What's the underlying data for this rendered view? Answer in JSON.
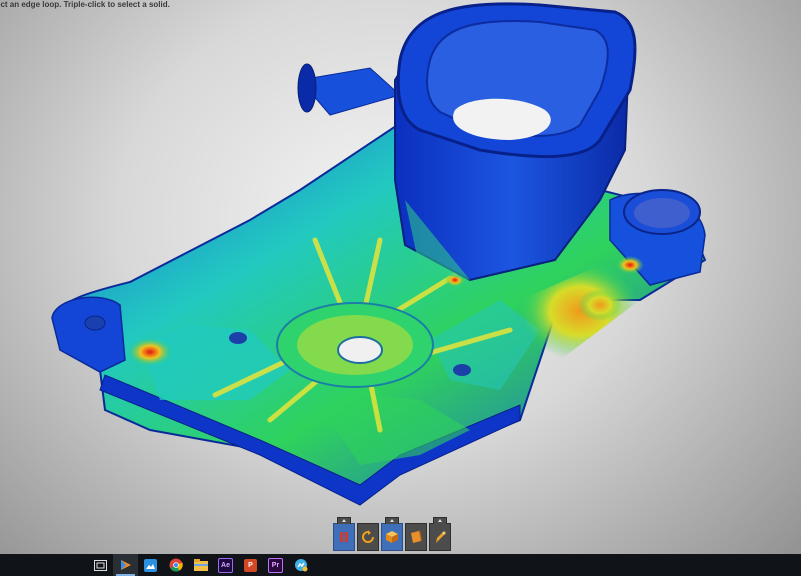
{
  "status": {
    "hint": "ect an edge loop. Triple-click to select a solid."
  },
  "toolbar": {
    "buttons": [
      {
        "icon": "pause-icon",
        "active": true
      },
      {
        "icon": "rotate-icon",
        "active": false
      },
      {
        "icon": "cube-view-icon",
        "active": true
      },
      {
        "icon": "section-icon",
        "active": false
      },
      {
        "icon": "probe-icon",
        "active": false
      }
    ]
  },
  "taskbar": {
    "items": [
      {
        "icon": "task-view-icon"
      },
      {
        "icon": "fusion-app-icon",
        "active": true
      },
      {
        "icon": "photos-app-icon"
      },
      {
        "icon": "chrome-browser-icon"
      },
      {
        "icon": "file-explorer-icon"
      },
      {
        "icon": "after-effects-icon",
        "label": "Ae"
      },
      {
        "icon": "powerpoint-icon",
        "label": "P"
      },
      {
        "icon": "premiere-icon",
        "label": "Pr"
      },
      {
        "icon": "messaging-app-icon"
      }
    ]
  },
  "colors": {
    "stress_low": "#0a2fc8",
    "stress_mid": "#27d35a",
    "stress_high": "#e81e12",
    "accent": "#3f6fb8"
  }
}
